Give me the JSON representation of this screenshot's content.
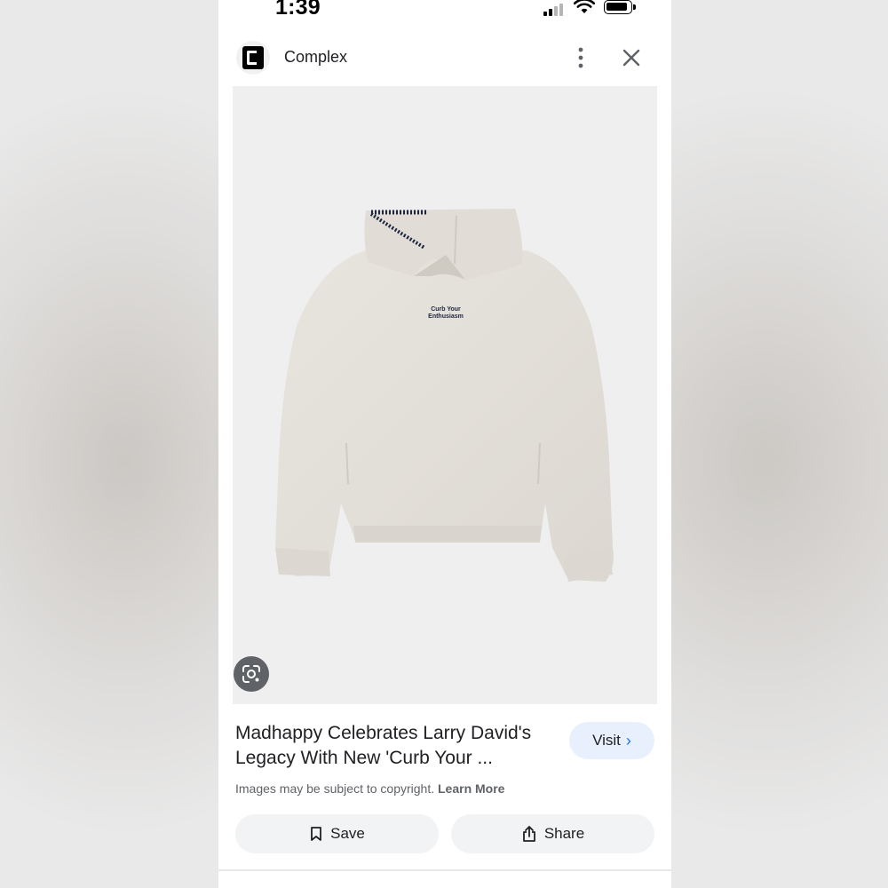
{
  "status_bar": {
    "time": "1:39"
  },
  "header": {
    "site_name": "Complex",
    "logo_icon": "complex-c-logo-icon",
    "more_icon": "more-vert-icon",
    "close_icon": "close-icon"
  },
  "image": {
    "alt": "Heather grey hoodie with navy stitching and 'Curb Your Enthusiasm' chest embroidery",
    "print_line1": "Curb Your",
    "print_line2": "Enthusiasm",
    "lens_icon": "lens-icon"
  },
  "result": {
    "title": "Madhappy Celebrates Larry David's Legacy With New 'Curb Your ...",
    "visit_label": "Visit",
    "copyright_text": "Images may be subject to copyright.",
    "learn_more": "Learn More"
  },
  "actions": {
    "save_label": "Save",
    "share_label": "Share"
  },
  "colors": {
    "accent": "#1a73e8",
    "visit_bg": "#e8f0fe",
    "button_bg": "#f1f3f4",
    "hoodie": "#e4e0da",
    "stitch": "#1e2540"
  }
}
